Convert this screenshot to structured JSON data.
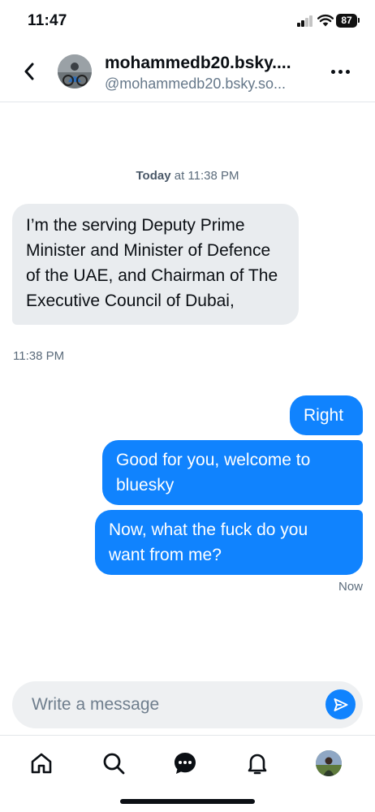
{
  "status_bar": {
    "time": "11:47",
    "battery": "87"
  },
  "header": {
    "display_name": "mohammedb20.bsky....",
    "handle": "@mohammedb20.bsky.so...",
    "avatar": "profile-photo"
  },
  "conversation": {
    "date_day": "Today",
    "date_time": " at 11:38 PM",
    "messages": [
      {
        "direction": "incoming",
        "text": "I’m the serving Deputy Prime Minister and Minister of Defence of the UAE, and Chairman of The Executive Council of Dubai,",
        "time": "11:38 PM"
      },
      {
        "direction": "outgoing",
        "text": "Right"
      },
      {
        "direction": "outgoing",
        "text": "Good for you, welcome to bluesky"
      },
      {
        "direction": "outgoing",
        "text": "Now, what the fuck do you want from me?",
        "time": "Now"
      }
    ]
  },
  "composer": {
    "placeholder": "Write a message"
  },
  "icons": {
    "back": "chevron-left-icon",
    "more": "more-horizontal-icon",
    "send": "send-icon",
    "nav": [
      "home-icon",
      "search-icon",
      "chat-icon",
      "bell-icon",
      "profile-avatar"
    ]
  },
  "colors": {
    "accent": "#1083fe",
    "incoming_bubble": "#e9ecef",
    "muted_text": "#5b6b7b"
  }
}
